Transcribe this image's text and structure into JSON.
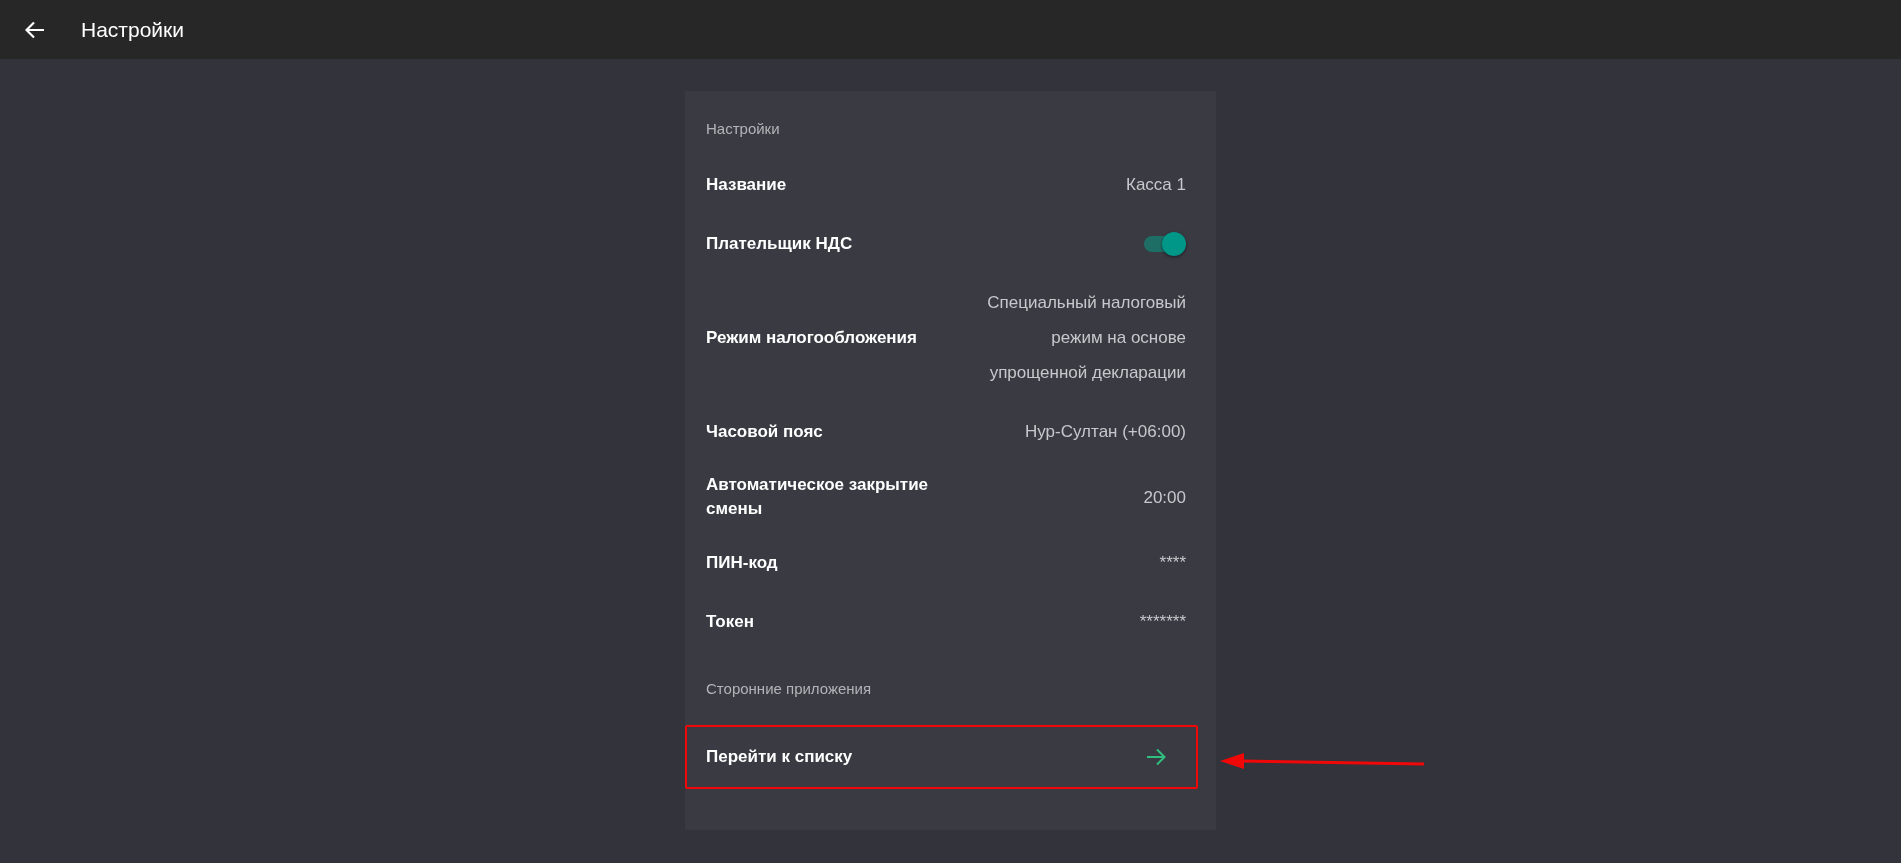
{
  "app_bar": {
    "title": "Настройки"
  },
  "sections": [
    {
      "title": "Настройки",
      "rows": [
        {
          "kind": "value",
          "label": "Название",
          "value": "Касса 1"
        },
        {
          "kind": "switch",
          "label": "Плательщик НДС",
          "on": true
        },
        {
          "kind": "value",
          "label": "Режим налогообложения",
          "value": "Специальный налоговый режим на основе упрощенной декларации"
        },
        {
          "kind": "value",
          "label": "Часовой пояс",
          "value": "Нур-Султан (+06:00)"
        },
        {
          "kind": "value",
          "label": "Автоматическое закрытие смены",
          "value": "20:00"
        },
        {
          "kind": "value",
          "label": "ПИН-код",
          "value": "****"
        },
        {
          "kind": "value",
          "label": "Токен",
          "value": "*******"
        }
      ]
    },
    {
      "title": "Сторонние приложения",
      "rows": [
        {
          "kind": "link",
          "label": "Перейти к списку",
          "highlighted": true
        }
      ]
    }
  ]
}
